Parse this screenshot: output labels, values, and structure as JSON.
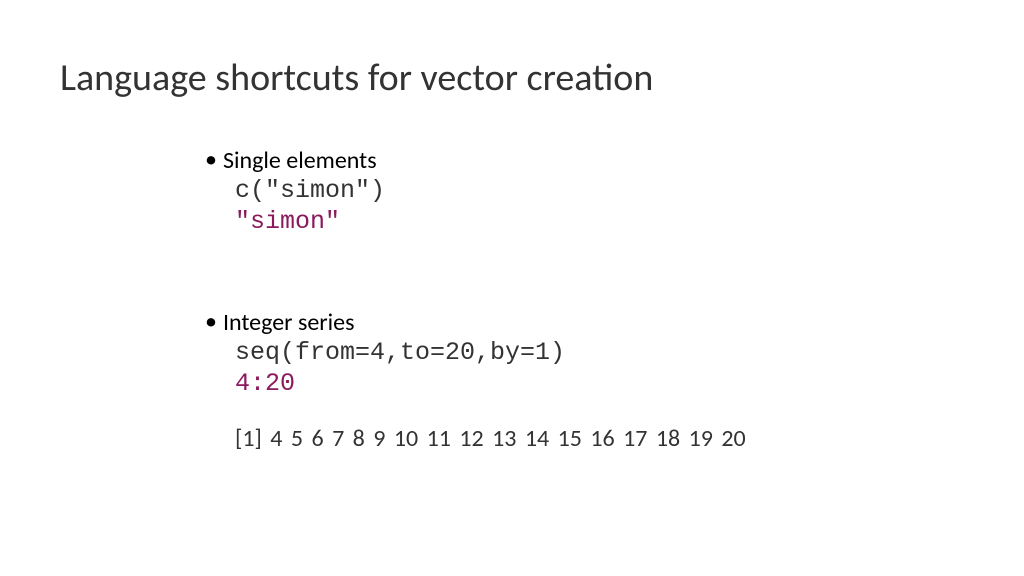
{
  "title": "Language shortcuts for vector creation",
  "section1": {
    "heading": "Single elements",
    "code_long": "c(\"simon\")",
    "code_short": "\"simon\""
  },
  "section2": {
    "heading": "Integer series",
    "code_long": "seq(from=4,to=20,by=1)",
    "code_short": "4:20",
    "output": "[1]  4  5  6  7  8  9 10 11 12 13 14 15 16 17 18 19 20"
  }
}
